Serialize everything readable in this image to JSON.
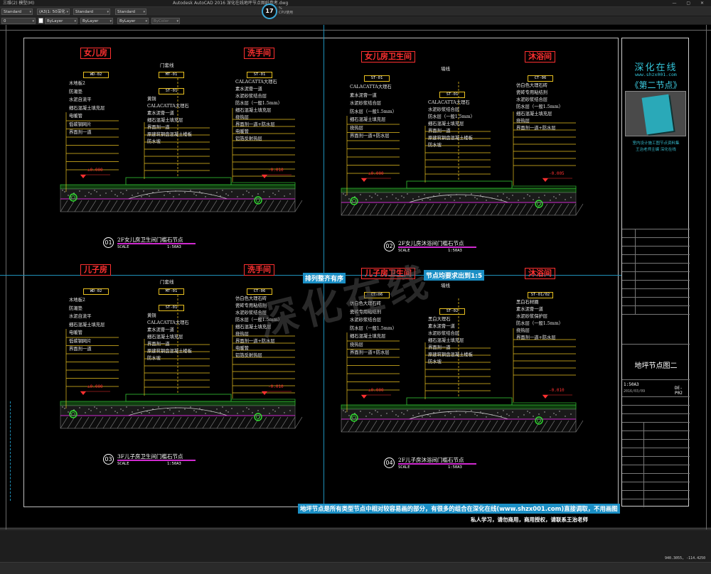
{
  "app": {
    "title_left": "三维(2) 模型(M)",
    "title": "Autodesk AutoCAD 2016    深化在线地坪节点图纸参考.dwg",
    "window_buttons": "— ▢ ✕"
  },
  "toolbar": {
    "text_style": "Standard",
    "dim_style": "ISO-25",
    "scale_combo": "(A3)1: 50深化",
    "table_style": "Standard",
    "mleader_style": "Standard",
    "layer": "0",
    "color": "ByLayer",
    "linetype": "ByLayer",
    "lineweight": "ByLayer",
    "plotstyle": "ByColor"
  },
  "cpu": {
    "value": "17",
    "unit": "%",
    "label": "CPU使用"
  },
  "title_block": {
    "brand": "深化在线",
    "url": "www.shzx001.com",
    "subtitle": "《第二节点》",
    "book_caption": "室内设计施工图节点资料集",
    "book_caption2": "王治老师主编 深化在线",
    "sheet_name": "地坪节点图二",
    "scale": "1:50A3",
    "date": "2016/03/09",
    "sheet_no": "DE-P02",
    "rows": [
      "",
      "",
      "",
      "",
      "",
      "",
      "",
      "",
      "",
      "",
      "",
      ""
    ]
  },
  "details": [
    {
      "num": "01",
      "room_left": "女儿房",
      "room_right": "洗手间",
      "code_l1": "WD-02",
      "code_l2": "MT-01",
      "code_l3": "ST-01",
      "code_r1": "ST-01",
      "wall_label": "门套线",
      "left_labels": [
        "木地板2",
        "防潮垫",
        "水泥自流平",
        "细石混凝土填充层",
        "电暖管",
        "低碳钢网片",
        "界面剂一道"
      ],
      "mid_labels": [
        "黄铜",
        "CALACATTA大理石",
        "素水泥膏一道",
        "细石混凝土填充层",
        "界面剂一道",
        "原建筑钢盘混凝土楼板",
        "防水坡"
      ],
      "right_labels": [
        "CALACATTA大理石",
        "素水泥膏一道",
        "水泥砂浆结合层",
        "防水层（一般1.5mm）",
        "细石混凝土填充层",
        "挠热层",
        "界面剂一道+防水层",
        "电暖管",
        "铝箔反射热层"
      ],
      "elev_left": "±0.000",
      "elev_right": "-0.010",
      "caption": "2F女儿房卫生间门槛石节点",
      "scale_label": "SCALE",
      "scale": "1:50A3"
    },
    {
      "num": "02",
      "room_left": "女儿房卫生间",
      "room_right": "沐浴间",
      "code_l1": "ST-01",
      "code_l3": "ST-01",
      "code_r1": "CT-06",
      "wall_label": "墙线",
      "left_labels": [
        "CALACATTA大理石",
        "素水泥膏一道",
        "水泥砂浆结合层",
        "防水层（一般1.5mm）",
        "细石混凝土填充层",
        "挠热层",
        "界面剂一道+防水层"
      ],
      "mid_labels": [
        "CALACATTA大理石",
        "水泥砂浆结合层",
        "防水层（一般1.5mm）",
        "细石混凝土填充层",
        "界面剂一道",
        "原建筑钢盘混凝土楼板",
        "防水坡"
      ],
      "right_labels": [
        "仿白色大理石砖",
        "瓷砖专用粘结剂",
        "水泥砂浆结合层",
        "防水层（一般1.5mm）",
        "细石混凝土填充层",
        "挠热层",
        "界面剂一道+防水层"
      ],
      "elev_left": "±0.000",
      "elev_right": "-0.005",
      "caption": "2F女儿房沐浴间门槛石节点",
      "scale_label": "SCALE",
      "scale": "1:50A3"
    },
    {
      "num": "03",
      "room_left": "儿子房",
      "room_right": "洗手间",
      "code_l1": "WD-02",
      "code_l2": "MT-01",
      "code_l3": "ST-01",
      "code_r1": "CT-06",
      "wall_label": "门套线",
      "left_labels": [
        "木地板2",
        "防潮垫",
        "水泥自流平",
        "细石混凝土填充层",
        "电暖管",
        "低碳钢网片",
        "界面剂一道"
      ],
      "mid_labels": [
        "黄铜",
        "CALACATTA大理石",
        "素水泥膏一道",
        "细石混凝土填充层",
        "界面剂一道",
        "原建筑钢盘混凝土楼板",
        "防水坡"
      ],
      "right_labels": [
        "仿白色大理石砖",
        "瓷砖专用粘结剂",
        "水泥砂浆结合层",
        "防水层（一般1.5mm）",
        "细石混凝土填充层",
        "挠热层",
        "界面剂一道+防水层",
        "电暖管",
        "铝箔反射热层"
      ],
      "elev_left": "±0.000",
      "elev_right": "-0.010",
      "caption": "3F儿子房卫生间门槛石节点",
      "scale_label": "SCALE",
      "scale": "1:50A3"
    },
    {
      "num": "04",
      "room_left": "儿子房卫生间",
      "room_right": "沐浴间",
      "code_l1": "CT-06",
      "code_l3": "ST-02",
      "code_r1": "ST-01/02",
      "wall_label": "墙线",
      "left_labels": [
        "仿白色大理石砖",
        "瓷砖专用粘结剂",
        "水泥砂浆结合层",
        "防水层（一般1.5mm）",
        "细石混凝土填充层",
        "挠热层",
        "界面剂一道+防水层"
      ],
      "mid_labels": [
        "黑白大理石",
        "素水泥膏一道",
        "水泥砂浆结合层",
        "细石混凝土填充层",
        "界面剂一道",
        "原建筑钢盘混凝土楼板",
        "防水坡"
      ],
      "right_labels": [
        "黑白石材圈",
        "素水泥膏一道",
        "水泥砂浆保护层",
        "防水层（一般1.5mm）",
        "挠热层",
        "界面剂一道+防水层"
      ],
      "elev_left": "±0.000",
      "elev_right": "-0.010",
      "caption": "2F儿子房沐浴间门槛石节点",
      "scale_label": "SCALE",
      "scale": "1:50A3"
    }
  ],
  "banners": {
    "arrange": "排列整齐有序",
    "output": "节点均要求出到1:5",
    "footer": "地坪节点是所有类型节点中相对较容易画的部分，有很多的组合在深化在线(www.shzx001.com)直接调取，不用画图",
    "notice": "私人学习，请勿商用，商用授权，请联系王治老师"
  },
  "watermark": "深化在线",
  "status": {
    "coords": "940.3055, -114.4250"
  }
}
